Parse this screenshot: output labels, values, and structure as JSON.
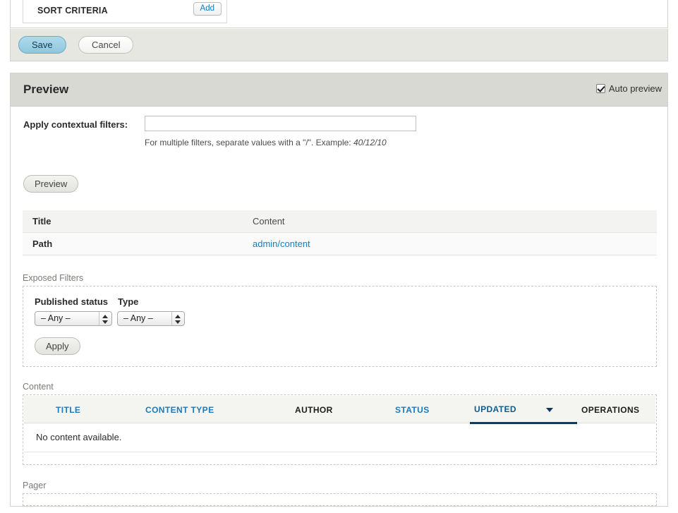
{
  "sort_section": {
    "label": "SORT CRITERIA",
    "add_label": "Add"
  },
  "actions": {
    "save_label": "Save",
    "cancel_label": "Cancel"
  },
  "preview": {
    "title": "Preview",
    "auto_preview_label": "Auto preview",
    "auto_preview_checked": true,
    "contextual_filters_label": "Apply contextual filters:",
    "contextual_filters_value": "",
    "contextual_filters_placeholder": "",
    "help_prefix": "For multiple filters, separate values with a \"/\". Example: ",
    "help_example": "40/12/10",
    "preview_button_label": "Preview"
  },
  "info_table": {
    "rows": [
      {
        "key": "Title",
        "value": "Content",
        "is_link": false
      },
      {
        "key": "Path",
        "value": "admin/content",
        "is_link": true
      }
    ]
  },
  "exposed_filters": {
    "section_label": "Exposed Filters",
    "published_status_label": "Published status",
    "type_label": "Type",
    "published_status_value": "– Any –",
    "type_value": "– Any –",
    "apply_label": "Apply"
  },
  "content_section": {
    "section_label": "Content",
    "columns": [
      {
        "label": "TITLE",
        "link": true,
        "active": false
      },
      {
        "label": "CONTENT TYPE",
        "link": true,
        "active": false
      },
      {
        "label": "AUTHOR",
        "link": false,
        "active": false
      },
      {
        "label": "STATUS",
        "link": true,
        "active": false
      },
      {
        "label": "UPDATED",
        "link": true,
        "active": true,
        "sort": "desc"
      },
      {
        "label": "OPERATIONS",
        "link": false,
        "active": false
      }
    ],
    "empty_text": "No content available."
  },
  "pager_section": {
    "section_label": "Pager"
  },
  "colors": {
    "link_blue": "#1b7bbd",
    "active_sort": "#0e3a5c",
    "save_button": "#8fc7dd",
    "panel_header": "#d9d9d3",
    "toolbar_bg": "#e7e7e2"
  }
}
